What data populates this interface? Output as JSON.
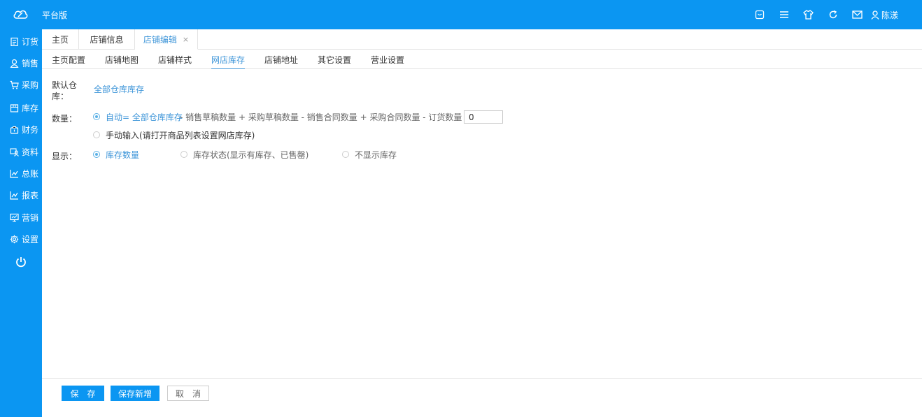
{
  "header": {
    "app_title": "平台版",
    "user_name": "陈漾",
    "icons": [
      "tablet-icon",
      "menu-icon",
      "shirt-icon",
      "refresh-icon",
      "mail-icon",
      "user-icon"
    ]
  },
  "sidebar": {
    "items": [
      {
        "label": "订货",
        "icon": "clipboard-icon"
      },
      {
        "label": "销售",
        "icon": "person-icon"
      },
      {
        "label": "采购",
        "icon": "cart-icon"
      },
      {
        "label": "库存",
        "icon": "box-icon"
      },
      {
        "label": "财务",
        "icon": "bag-icon"
      },
      {
        "label": "资料",
        "icon": "people-icon"
      },
      {
        "label": "总账",
        "icon": "chart-icon"
      },
      {
        "label": "报表",
        "icon": "chart-icon"
      },
      {
        "label": "营销",
        "icon": "monitor-icon"
      },
      {
        "label": "设置",
        "icon": "gear-icon"
      }
    ],
    "power_icon": "power-icon"
  },
  "tabs": [
    {
      "label": "主页"
    },
    {
      "label": "店铺信息"
    },
    {
      "label": "店铺编辑",
      "active": true,
      "close": "×"
    }
  ],
  "subtabs": [
    {
      "label": "主页配置"
    },
    {
      "label": "店铺地图"
    },
    {
      "label": "店铺样式"
    },
    {
      "label": "网店库存",
      "active": true
    },
    {
      "label": "店铺地址"
    },
    {
      "label": "其它设置"
    },
    {
      "label": "营业设置"
    }
  ],
  "form": {
    "warehouse_label_1": "默认仓",
    "warehouse_label_2": "库：",
    "warehouse_value": "全部仓库库存",
    "quantity_label": "数量：",
    "auto_option_prefix": "自动= 全部仓库库存",
    "auto_option_formula": " - 销售草稿数量 + 采购草稿数量 - 销售合同数量 + 采购合同数量 - 订货数量 -",
    "auto_value": "0",
    "manual_option": "手动输入(请打开商品列表设置网店库存)",
    "display_label": "显示：",
    "display_options": [
      "库存数量",
      "库存状态(显示有库存、已售罄)",
      "不显示库存"
    ],
    "selected_quantity_mode": "auto",
    "selected_display": 0
  },
  "footer": {
    "save": "保　存",
    "save_new": "保存新增",
    "cancel": "取　消"
  },
  "colors": {
    "brand": "#0b96f2",
    "link": "#3f96d9"
  }
}
